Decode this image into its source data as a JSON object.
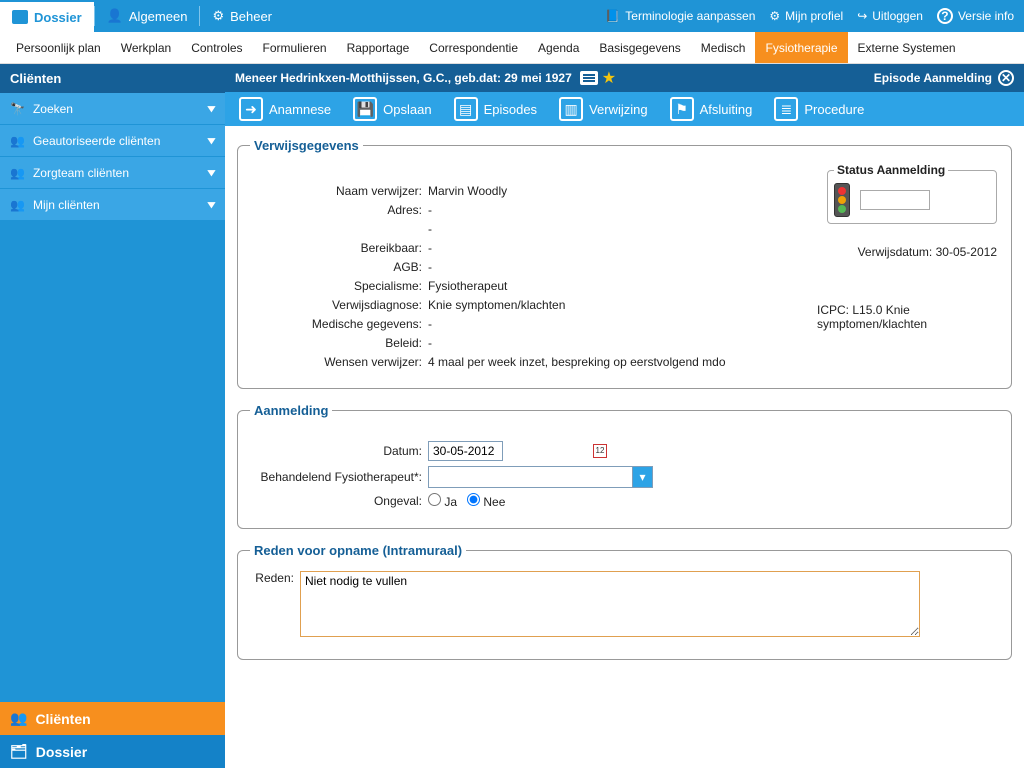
{
  "top_tabs": [
    {
      "label": "Dossier",
      "active": true
    },
    {
      "label": "Algemeen",
      "active": false
    },
    {
      "label": "Beheer",
      "active": false
    }
  ],
  "top_links": {
    "terminologie": "Terminologie aanpassen",
    "profiel": "Mijn profiel",
    "uitloggen": "Uitloggen",
    "versie": "Versie info"
  },
  "subnav": [
    "Persoonlijk plan",
    "Werkplan",
    "Controles",
    "Formulieren",
    "Rapportage",
    "Correspondentie",
    "Agenda",
    "Basisgegevens",
    "Medisch",
    "Fysiotherapie",
    "Externe Systemen"
  ],
  "subnav_active": "Fysiotherapie",
  "sidebar_header": "Cliënten",
  "sidebar_items": [
    "Zoeken",
    "Geautoriseerde cliënten",
    "Zorgteam cliënten",
    "Mijn cliënten"
  ],
  "bottom_tabs": [
    {
      "label": "Cliënten",
      "active": true
    },
    {
      "label": "Dossier",
      "active": false
    }
  ],
  "patient_title": "Meneer Hedrinkxen-Motthijssen, G.C., geb.dat: 29 mei 1927",
  "episode_title": "Episode Aanmelding",
  "toolbar": {
    "anamnese": "Anamnese",
    "opslaan": "Opslaan",
    "episodes": "Episodes",
    "verwijzing": "Verwijzing",
    "afsluiting": "Afsluiting",
    "procedure": "Procedure"
  },
  "verwijs": {
    "legend": "Verwijsgegevens",
    "status_legend": "Status Aanmelding",
    "verwijsdatum_label": "Verwijsdatum:",
    "verwijsdatum": "30-05-2012",
    "icpc_label": "ICPC:",
    "icpc": "L15.0 Knie symptomen/klachten",
    "rows": {
      "Naam verwijzer:": "Marvin Woodly",
      "Adres:": "-",
      "dash_row": "-",
      "Bereikbaar:": "-",
      "AGB:": "-",
      "Specialisme:": "Fysiotherapeut",
      "Verwijsdiagnose:": "Knie symptomen/klachten",
      "Medische gegevens:": "-",
      "Beleid:": "-",
      "Wensen verwijzer:": "4 maal per week inzet, bespreking op eerstvolgend mdo"
    }
  },
  "aanmelding": {
    "legend": "Aanmelding",
    "datum_label": "Datum:",
    "datum_value": "30-05-2012",
    "beh_label": "Behandelend Fysiotherapeut*:",
    "ongeval_label": "Ongeval:",
    "ongeval_ja": "Ja",
    "ongeval_nee": "Nee"
  },
  "reden": {
    "legend": "Reden voor opname (Intramuraal)",
    "label": "Reden:",
    "value": "Niet nodig te vullen"
  }
}
